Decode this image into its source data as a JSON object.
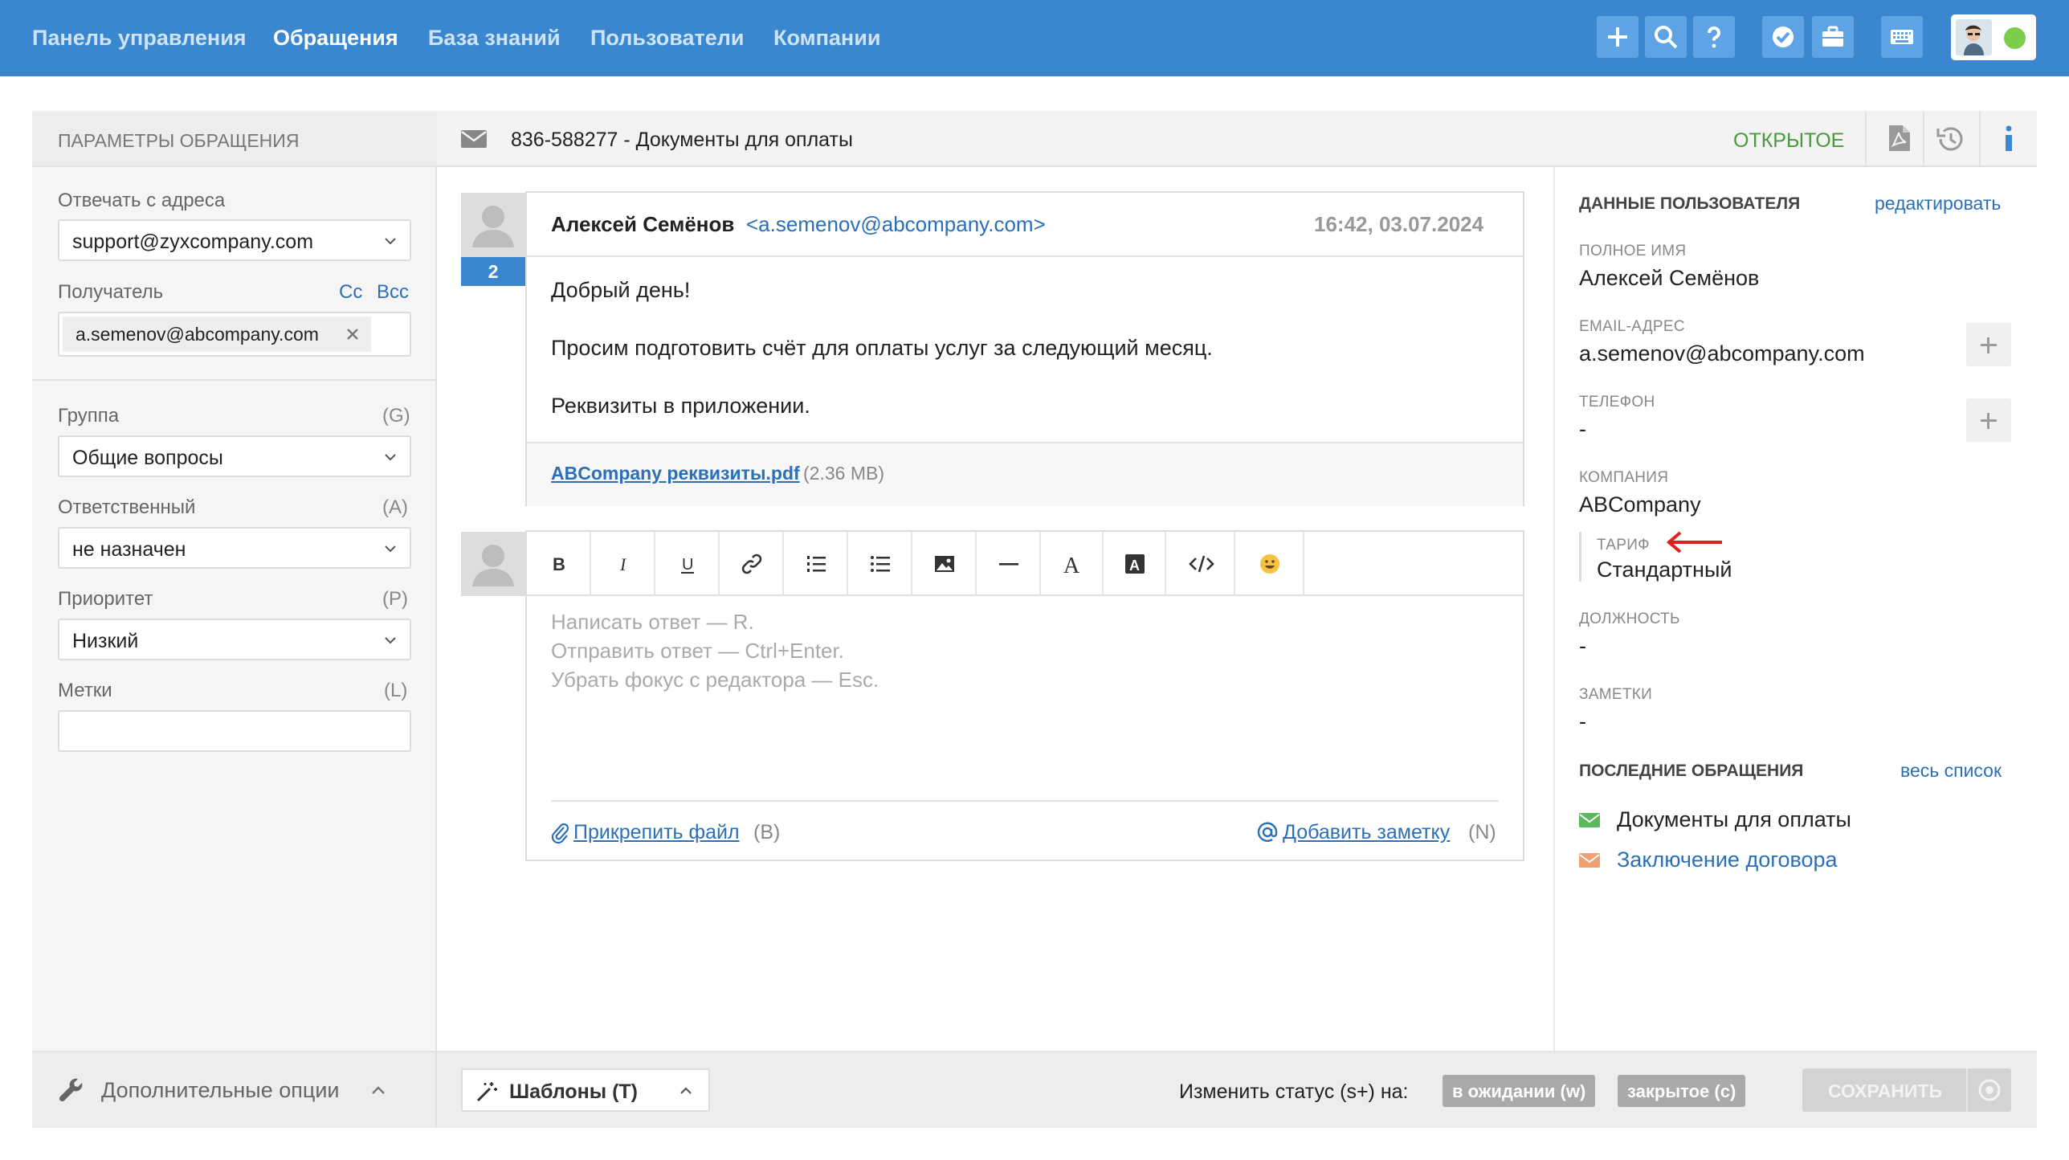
{
  "nav": {
    "dashboard": "Панель управления",
    "tickets": "Обращения",
    "knowledge_base": "База знаний",
    "users": "Пользователи",
    "companies": "Компании"
  },
  "toolbar_icons": [
    "plus-icon",
    "search-icon",
    "help-icon",
    "check-badge-icon",
    "briefcase-icon",
    "keyboard-icon"
  ],
  "left": {
    "header": "ПАРАМЕТРЫ ОБРАЩЕНИЯ",
    "reply_from_label": "Отвечать с адреса",
    "reply_from_value": "support@zyxcompany.com",
    "recipient_label": "Получатель",
    "cc": "Cc",
    "bcc": "Bcc",
    "recipient_tag": "a.semenov@abcompany.com",
    "group_label": "Группа",
    "group_key": "(G)",
    "group_value": "Общие вопросы",
    "assignee_label": "Ответственный",
    "assignee_key": "(A)",
    "assignee_value": "не назначен",
    "priority_label": "Приоритет",
    "priority_key": "(P)",
    "priority_value": "Низкий",
    "tags_label": "Метки",
    "tags_key": "(L)",
    "tags_value": ""
  },
  "ticket": {
    "subject": "836-588277 - Документы для оплаты",
    "status": "ОТКРЫТОЕ"
  },
  "message": {
    "author": "Алексей Семёнов",
    "email": "<a.semenov@abcompany.com>",
    "time": "16:42, 03.07.2024",
    "count": "2",
    "line1": "Добрый день!",
    "line2": "Просим подготовить счёт для оплаты услуг за следующий месяц.",
    "line3": "Реквизиты в приложении.",
    "attachment_name": "ABCompany реквизиты.pdf",
    "attachment_size": "(2.36 MB)"
  },
  "editor": {
    "placeholder1": "Написать ответ — R.",
    "placeholder2": "Отправить ответ — Ctrl+Enter.",
    "placeholder3": "Убрать фокус с редактора — Esc.",
    "attach_file": "Прикрепить файл",
    "attach_key": "(B)",
    "add_note": "Добавить заметку",
    "note_key": "(N)"
  },
  "user_data": {
    "header": "ДАННЫЕ ПОЛЬЗОВАТЕЛЯ",
    "edit": "редактировать",
    "fullname_label": "ПОЛНОЕ ИМЯ",
    "fullname": "Алексей Семёнов",
    "email_label": "EMAIL-АДРЕС",
    "email": "a.semenov@abcompany.com",
    "phone_label": "ТЕЛЕФОН",
    "phone": "-",
    "company_label": "КОМПАНИЯ",
    "company": "ABCompany",
    "tariff_label": "ТАРИФ",
    "tariff": "Стандартный",
    "position_label": "ДОЛЖНОСТЬ",
    "position": "-",
    "notes_label": "ЗАМЕТКИ",
    "notes": "-"
  },
  "recent": {
    "header": "ПОСЛЕДНИЕ ОБРАЩЕНИЯ",
    "all": "весь список",
    "items": [
      {
        "title": "Документы для оплаты",
        "color": "#5cb85c"
      },
      {
        "title": "Заключение договора",
        "color": "#f0a070"
      }
    ]
  },
  "bottom": {
    "more_options": "Дополнительные опции",
    "templates": "Шаблоны (T)",
    "change_status": "Изменить статус (s+) на:",
    "waiting": "в ожидании (w)",
    "closed": "закрытое (c)",
    "save": "СОХРАНИТЬ"
  },
  "colors": {
    "nav_bg": "#3a87cf",
    "accent_blue": "#2a6fb8",
    "status_green": "#4a9a3c",
    "annotation_arrow": "#e02020"
  }
}
